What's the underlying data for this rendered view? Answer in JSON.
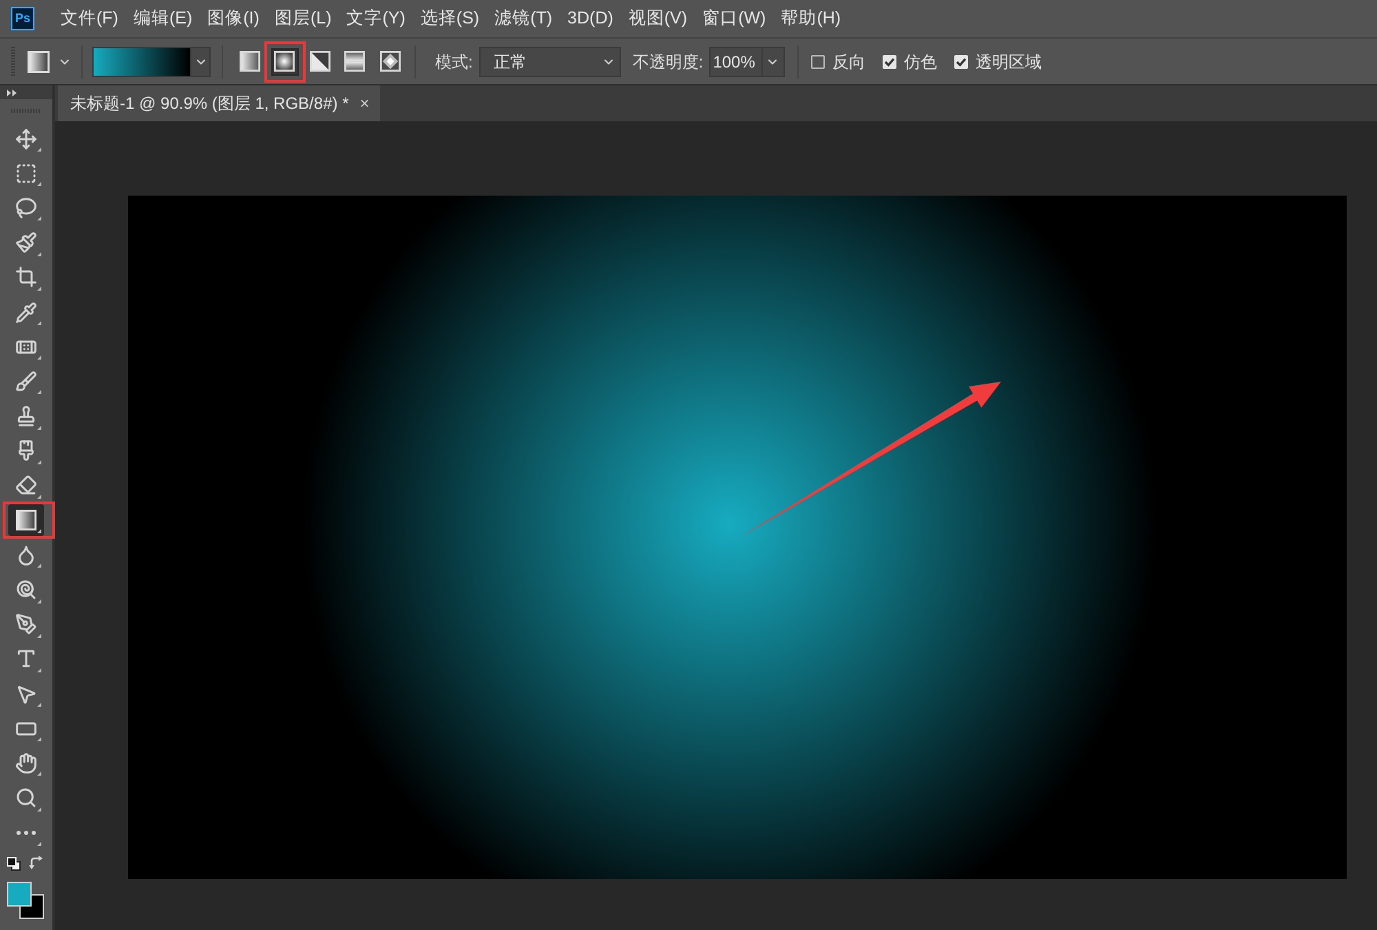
{
  "app": {
    "logo": "Ps"
  },
  "menu": [
    "文件(F)",
    "编辑(E)",
    "图像(I)",
    "图层(L)",
    "文字(Y)",
    "选择(S)",
    "滤镜(T)",
    "3D(D)",
    "视图(V)",
    "窗口(W)",
    "帮助(H)"
  ],
  "options_bar": {
    "gradient_styles": [
      {
        "kind": "linear",
        "selected": false,
        "highlighted": false
      },
      {
        "kind": "radial",
        "selected": true,
        "highlighted": true
      },
      {
        "kind": "angle",
        "selected": false,
        "highlighted": false
      },
      {
        "kind": "reflected",
        "selected": false,
        "highlighted": false
      },
      {
        "kind": "diamond",
        "selected": false,
        "highlighted": false
      }
    ],
    "mode": {
      "label": "模式:",
      "value": "正常"
    },
    "opacity": {
      "label": "不透明度:",
      "value": "100%"
    },
    "checkboxes": [
      {
        "label": "反向",
        "checked": false
      },
      {
        "label": "仿色",
        "checked": true
      },
      {
        "label": "透明区域",
        "checked": true
      }
    ]
  },
  "document_tab": {
    "title": "未标题-1 @ 90.9% (图层 1, RGB/8#) *",
    "close": "×"
  },
  "tools": [
    {
      "kind": "move",
      "selected": false,
      "highlighted": false
    },
    {
      "kind": "marquee",
      "selected": false,
      "highlighted": false
    },
    {
      "kind": "lasso",
      "selected": false,
      "highlighted": false
    },
    {
      "kind": "quick_select",
      "selected": false,
      "highlighted": false
    },
    {
      "kind": "crop",
      "selected": false,
      "highlighted": false
    },
    {
      "kind": "eyedropper",
      "selected": false,
      "highlighted": false
    },
    {
      "kind": "healing",
      "selected": false,
      "highlighted": false
    },
    {
      "kind": "brush",
      "selected": false,
      "highlighted": false
    },
    {
      "kind": "stamp",
      "selected": false,
      "highlighted": false
    },
    {
      "kind": "history_brush",
      "selected": false,
      "highlighted": false
    },
    {
      "kind": "eraser",
      "selected": false,
      "highlighted": false
    },
    {
      "kind": "gradient",
      "selected": true,
      "highlighted": true
    },
    {
      "kind": "blur",
      "selected": false,
      "highlighted": false
    },
    {
      "kind": "dodge",
      "selected": false,
      "highlighted": false
    },
    {
      "kind": "pen",
      "selected": false,
      "highlighted": false
    },
    {
      "kind": "type",
      "selected": false,
      "highlighted": false
    },
    {
      "kind": "path_select",
      "selected": false,
      "highlighted": false
    },
    {
      "kind": "rectangle",
      "selected": false,
      "highlighted": false
    },
    {
      "kind": "hand",
      "selected": false,
      "highlighted": false
    },
    {
      "kind": "zoom",
      "selected": false,
      "highlighted": false
    },
    {
      "kind": "more",
      "selected": false,
      "highlighted": false
    }
  ],
  "swatches": [
    {
      "kind": "foreground",
      "color": "#17abc0"
    },
    {
      "kind": "background",
      "color": "#000000"
    }
  ],
  "canvas": {
    "arrow": true
  }
}
